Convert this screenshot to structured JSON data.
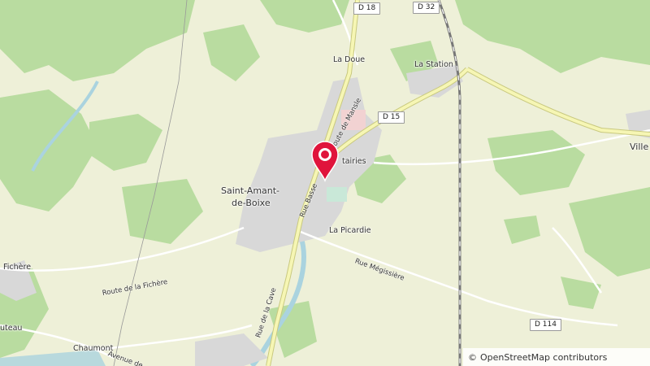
{
  "map": {
    "place_labels": {
      "la_doue": "La Doue",
      "la_station": "La Station",
      "saint_amant_1": "Saint-Amant-",
      "saint_amant_2": "de-Boixe",
      "metairies": "tairies",
      "la_picardie": "La Picardie",
      "fichere": "Fichère",
      "uteau": "uteau",
      "chaumont": "Chaumont",
      "ville": "Ville"
    },
    "road_shields": {
      "d18": "D 18",
      "d32": "D 32",
      "d15": "D 15",
      "d114": "D 114"
    },
    "street_labels": {
      "rue_basse": "Rue Basse",
      "route_de_mansle": "oute de Mansle",
      "route_fichere": "Route de la Fichère",
      "rue_megissiere": "Rue Mégissière",
      "rue_de_la_cave": "Rue de la Cave",
      "avenue": "Avenue de"
    },
    "marker_icon": "location-pin-icon",
    "marker_color": "#e0143c",
    "attribution": {
      "symbol": "©",
      "text": "OpenStreetMap contributors"
    },
    "colors": {
      "land": "#eef0d8",
      "forest": "#b9dca0",
      "urban": "#d8d8d8",
      "road_major": "#f6f6b4",
      "water": "#aad3df"
    }
  }
}
